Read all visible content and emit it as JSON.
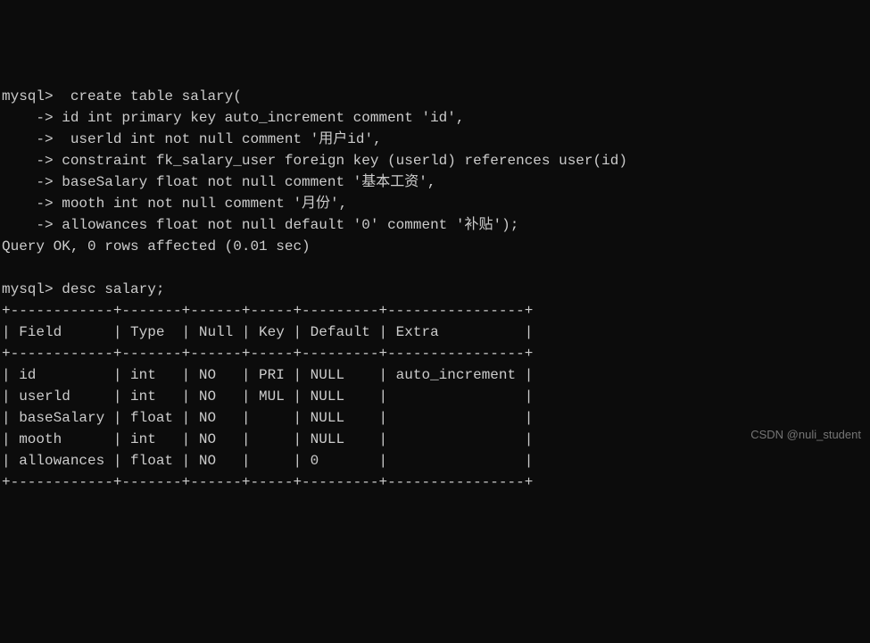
{
  "chart_data": {
    "type": "table",
    "title": "desc salary",
    "columns": [
      "Field",
      "Type",
      "Null",
      "Key",
      "Default",
      "Extra"
    ],
    "rows": [
      {
        "Field": "id",
        "Type": "int",
        "Null": "NO",
        "Key": "PRI",
        "Default": "NULL",
        "Extra": "auto_increment"
      },
      {
        "Field": "userld",
        "Type": "int",
        "Null": "NO",
        "Key": "MUL",
        "Default": "NULL",
        "Extra": ""
      },
      {
        "Field": "baseSalary",
        "Type": "float",
        "Null": "NO",
        "Key": "",
        "Default": "NULL",
        "Extra": ""
      },
      {
        "Field": "mooth",
        "Type": "int",
        "Null": "NO",
        "Key": "",
        "Default": "NULL",
        "Extra": ""
      },
      {
        "Field": "allowances",
        "Type": "float",
        "Null": "NO",
        "Key": "",
        "Default": "0",
        "Extra": ""
      }
    ]
  },
  "prompt1": "mysql>  create table salary(",
  "line1": "    -> id int primary key auto_increment comment 'id',",
  "line2": "    ->  userld int not null comment '用户id',",
  "line3": "    -> constraint fk_salary_user foreign key (userld) references user(id)",
  "line4": "    -> baseSalary float not null comment '基本工资',",
  "line5": "    -> mooth int not null comment '月份',",
  "line6": "    -> allowances float not null default '0' comment '补贴');",
  "result1": "Query OK, 0 rows affected (0.01 sec)",
  "blank1": "",
  "prompt2": "mysql> desc salary;",
  "tborder": "+------------+-------+------+-----+---------+----------------+",
  "theader": "| Field      | Type  | Null | Key | Default | Extra          |",
  "trow0": "| id         | int   | NO   | PRI | NULL    | auto_increment |",
  "trow1": "| userld     | int   | NO   | MUL | NULL    |                |",
  "trow2": "| baseSalary | float | NO   |     | NULL    |                |",
  "trow3": "| mooth      | int   | NO   |     | NULL    |                |",
  "trow4": "| allowances | float | NO   |     | 0       |                |",
  "watermark": "CSDN @nuli_student"
}
